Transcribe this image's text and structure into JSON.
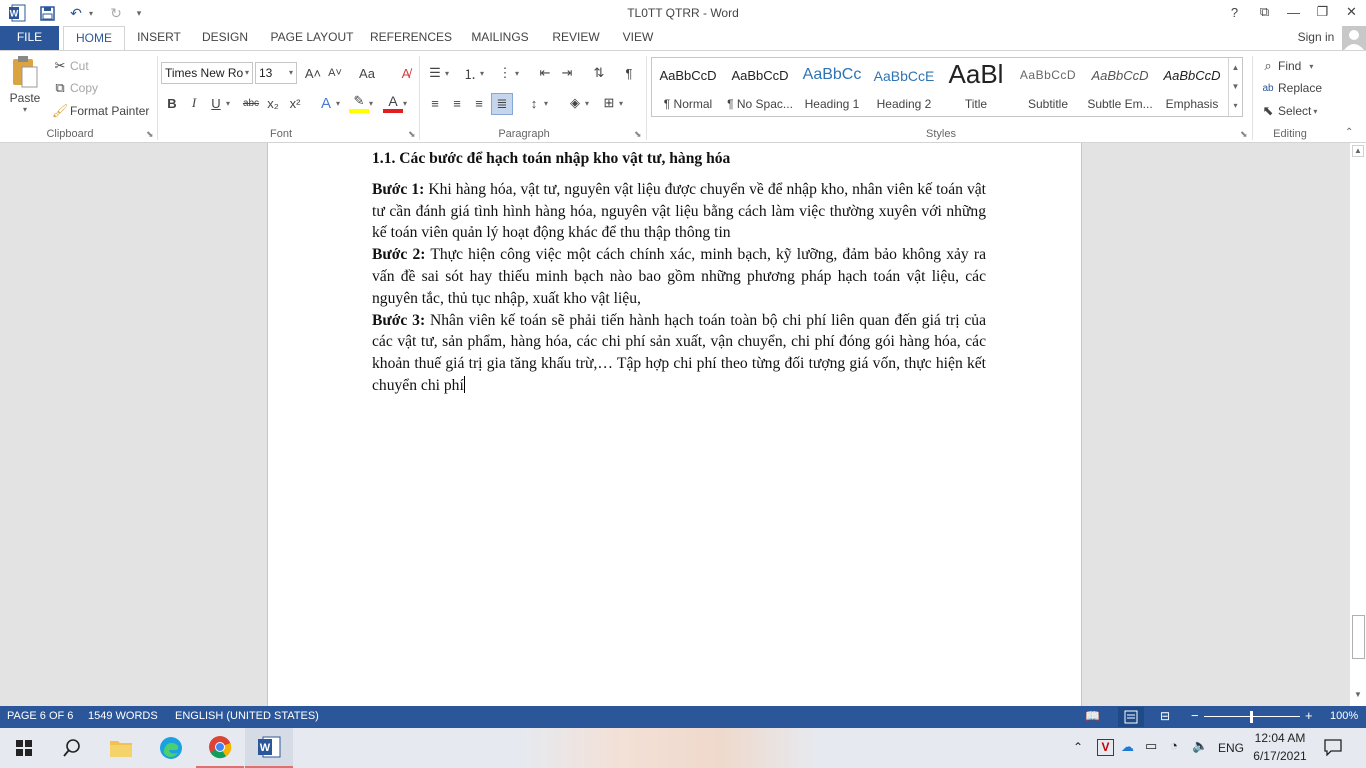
{
  "titlebar": {
    "title": "TL0TT QTRR - Word",
    "help": "?",
    "ribbon_display": "⧉",
    "minimize": "—",
    "restore": "❐",
    "close": "✕"
  },
  "tabs": {
    "file": "FILE",
    "home": "HOME",
    "insert": "INSERT",
    "design": "DESIGN",
    "page_layout": "PAGE LAYOUT",
    "references": "REFERENCES",
    "mailings": "MAILINGS",
    "review": "REVIEW",
    "view": "VIEW",
    "sign_in": "Sign in"
  },
  "clipboard": {
    "paste": "Paste",
    "cut": "Cut",
    "copy": "Copy",
    "format_painter": "Format Painter",
    "label": "Clipboard"
  },
  "font": {
    "family": "Times New Ro",
    "size": "13",
    "label": "Font",
    "bold": "B",
    "italic": "I",
    "underline": "U",
    "strike": "abc",
    "subscript": "x₂",
    "superscript": "x²",
    "grow": "A˄",
    "shrink": "A˅",
    "change_case": "Aa",
    "text_effects": "A",
    "font_color": "A"
  },
  "paragraph": {
    "label": "Paragraph"
  },
  "styles": {
    "label": "Styles",
    "items": [
      {
        "sample": "AaBbCcD",
        "name": "¶ Normal"
      },
      {
        "sample": "AaBbCcD",
        "name": "¶ No Spac..."
      },
      {
        "sample": "AaBbCc",
        "name": "Heading 1"
      },
      {
        "sample": "AaBbCcE",
        "name": "Heading 2"
      },
      {
        "sample": "AaBl",
        "name": "Title"
      },
      {
        "sample": "AaBbCcD",
        "name": "Subtitle"
      },
      {
        "sample": "AaBbCcD",
        "name": "Subtle Em..."
      },
      {
        "sample": "AaBbCcD",
        "name": "Emphasis"
      }
    ]
  },
  "editing": {
    "find": "Find",
    "replace": "Replace",
    "select": "Select",
    "label": "Editing"
  },
  "document": {
    "heading": "1.1. Các bước để hạch toán nhập kho vật tư, hàng hóa",
    "paragraphs": [
      {
        "lead": "Bước 1:",
        "text": " Khi hàng hóa, vật tư, nguyên vật liệu được chuyển về để nhập kho, nhân viên kế toán vật tư cần đánh giá tình hình hàng hóa, nguyên vật liệu bằng cách làm việc thường xuyên với những kế toán viên quản lý hoạt động khác để thu thập thông tin"
      },
      {
        "lead": "Bước 2:",
        "text": " Thực hiện công việc một cách chính xác, minh bạch, kỹ lưỡng, đảm bảo không xảy ra vấn đề sai sót hay thiếu minh bạch nào bao gồm những phương pháp hạch toán vật liệu, các nguyên tắc, thủ tục nhập, xuất kho vật liệu,"
      },
      {
        "lead": "Bước 3:",
        "text": " Nhân viên kế toán sẽ phải tiến hành hạch toán toàn bộ chi phí liên quan đến giá trị của các vật tư, sản phẩm, hàng hóa, các chi phí sản xuất, vận chuyển, chi phí đóng gói hàng hóa, các khoản thuế giá trị gia tăng khấu trừ,… Tập hợp chi phí theo từng đối tượng giá vốn, thực hiện kết chuyển chi phí"
      }
    ]
  },
  "status": {
    "page": "PAGE 6 OF 6",
    "words": "1549 WORDS",
    "language": "ENGLISH (UNITED STATES)",
    "zoom": "100%"
  },
  "taskbar": {
    "language": "ENG",
    "time": "12:04 AM",
    "date": "6/17/2021"
  },
  "colors": {
    "accent": "#2b579a",
    "page_bg": "#e3e3e3"
  }
}
